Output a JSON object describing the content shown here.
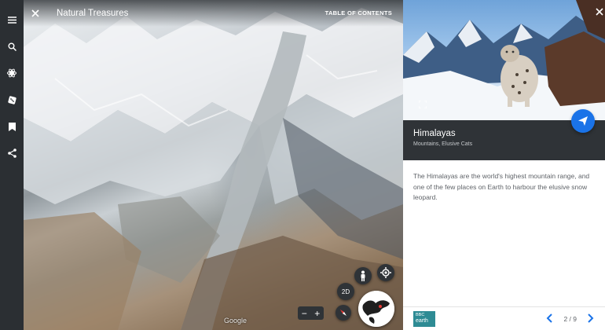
{
  "rail": {
    "items": [
      {
        "icon": "menu-icon"
      },
      {
        "icon": "search-icon"
      },
      {
        "icon": "voyager-icon"
      },
      {
        "icon": "dice-icon"
      },
      {
        "icon": "bookmark-icon"
      },
      {
        "icon": "share-icon"
      }
    ]
  },
  "header": {
    "tour_title": "Natural Treasures",
    "toc_label": "TABLE OF CONTENTS"
  },
  "map": {
    "watermark": "Google",
    "view_mode_label": "2D",
    "zoom_out_label": "−",
    "zoom_in_label": "+"
  },
  "card": {
    "title": "Himalayas",
    "subtitle": "Mountains, Elusive Cats",
    "description": "The Himalayas are the world's highest mountain range, and one of the few places on Earth to harbour the elusive snow leopard.",
    "logo_text_top": "BBC",
    "logo_text_bottom": "earth",
    "page_indicator": "2 / 9",
    "accent_color": "#1a73e8"
  }
}
